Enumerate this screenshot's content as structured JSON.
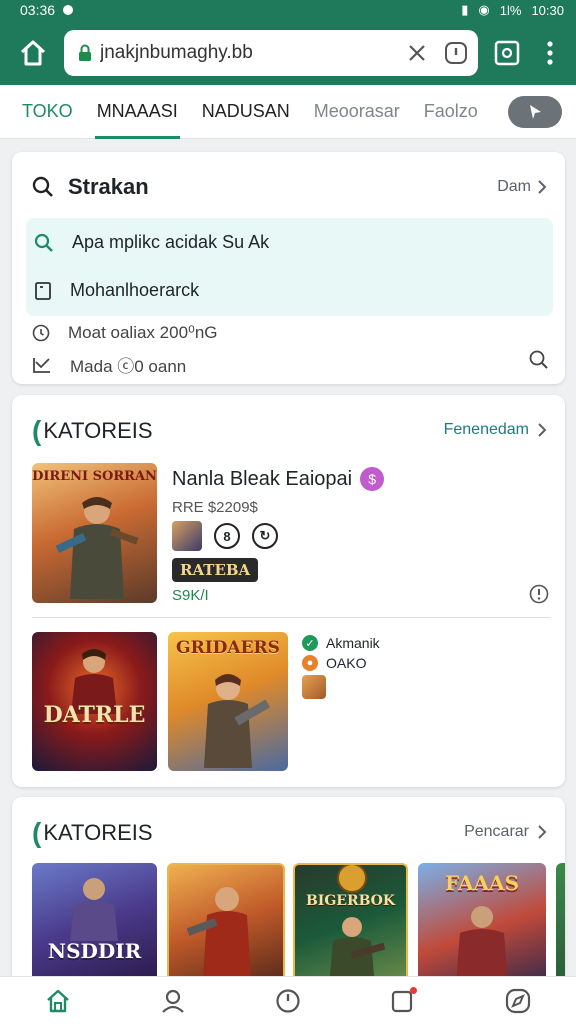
{
  "status_bar": {
    "time": "03:36",
    "right_text": "1l%",
    "clock_right": "10:30"
  },
  "url_bar": {
    "url": "jnakjnbumaghy.bb"
  },
  "tabs": [
    {
      "label": "TOKO",
      "style": "green"
    },
    {
      "label": "MNAAASI",
      "style": "active"
    },
    {
      "label": "NADUSAN",
      "style": "normal"
    },
    {
      "label": "Meoorasar",
      "style": "muted"
    },
    {
      "label": "Faolzo",
      "style": "muted"
    }
  ],
  "search": {
    "title": "Strakan",
    "more_label": "Dam",
    "suggestions": [
      {
        "icon": "search-icon",
        "text": "Apa mplikc acidak Su Ak"
      },
      {
        "icon": "bookmark-icon",
        "text": "Mohanlhoerarck"
      }
    ],
    "recent": [
      {
        "icon": "clock-icon",
        "text": "Moat oaliax 200⁰nG"
      },
      {
        "icon": "trend-icon",
        "text": "Mada  ⓒ0 oann"
      }
    ]
  },
  "category1": {
    "title": "KATOREIS",
    "more_label": "Fenenedam",
    "featured": {
      "art_label": "DIRENI SORRAN",
      "title": "Nanla Bleak Eaiopai",
      "price": "RRE $2209$",
      "tag": "RATEBA",
      "status": "S9K/I"
    },
    "tiles": [
      {
        "label": "DATRLE"
      },
      {
        "label": "GRIDAERS"
      }
    ],
    "status_list": [
      {
        "text": "Akmanik",
        "color": "#1f9a5a",
        "icon": "check-icon"
      },
      {
        "text": "OAKO",
        "color": "#e8812b",
        "icon": "dot-icon"
      }
    ]
  },
  "category2": {
    "title": "KATOREIS",
    "more_label": "Pencarar",
    "tiles": [
      {
        "label": "NSDDIR"
      },
      {
        "label": ""
      },
      {
        "label": "BIGERBOK"
      },
      {
        "label": "FAAAS"
      }
    ]
  },
  "bottom_nav": [
    {
      "name": "home-icon"
    },
    {
      "name": "profile-icon"
    },
    {
      "name": "clock-icon"
    },
    {
      "name": "notifications-icon"
    },
    {
      "name": "explore-icon"
    }
  ],
  "colors": {
    "primary": "#1f7a5c",
    "accent": "#1f8a66",
    "suggest_bg": "#e8f8f6"
  }
}
